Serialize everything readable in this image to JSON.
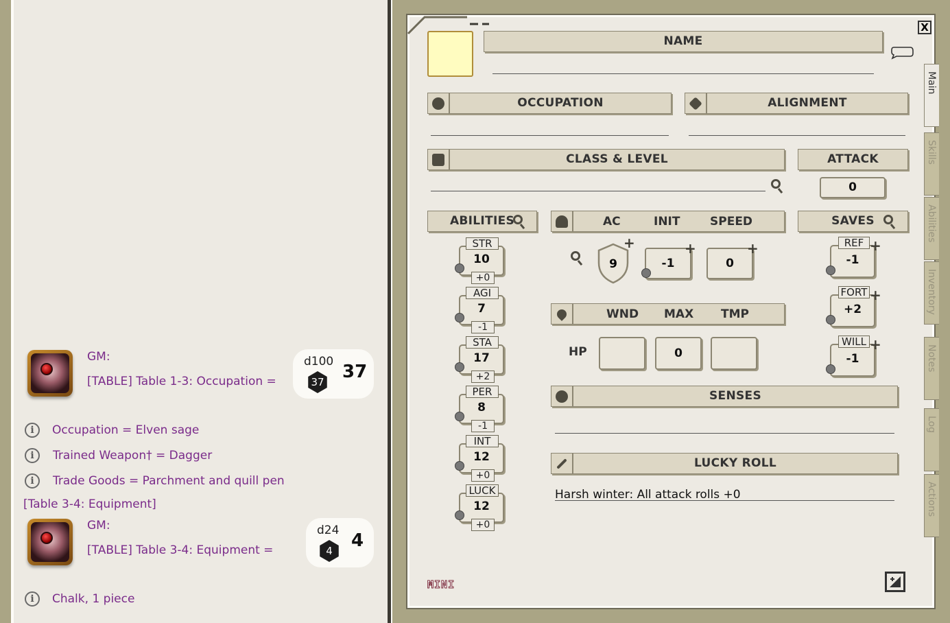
{
  "chat": {
    "msg1": {
      "speaker": "GM:",
      "text": "[TABLE] Table 1-3: Occupation =",
      "dice_label": "d100",
      "dice_roll": "37",
      "dice_total": "37"
    },
    "results1": [
      "Occupation = Elven sage",
      "Trained Weapon† = Dagger",
      "Trade Goods = Parchment and quill pen"
    ],
    "table_ref": "[Table 3-4: Equipment]",
    "msg2": {
      "speaker": "GM:",
      "text": "[TABLE] Table 3-4: Equipment =",
      "dice_label": "d24",
      "dice_roll": "4",
      "dice_total": "4"
    },
    "results2": [
      "Chalk, 1 piece"
    ]
  },
  "sheet": {
    "close": "X",
    "name_label": "NAME",
    "occupation_label": "OCCUPATION",
    "alignment_label": "ALIGNMENT",
    "class_level_label": "CLASS & LEVEL",
    "attack_label": "ATTACK",
    "attack_value": "0",
    "abilities_label": "ABILITIES",
    "abilities": [
      {
        "name": "STR",
        "value": "10",
        "mod": "+0"
      },
      {
        "name": "AGI",
        "value": "7",
        "mod": "-1"
      },
      {
        "name": "STA",
        "value": "17",
        "mod": "+2"
      },
      {
        "name": "PER",
        "value": "8",
        "mod": "-1"
      },
      {
        "name": "INT",
        "value": "12",
        "mod": "+0"
      },
      {
        "name": "LUCK",
        "value": "12",
        "mod": "+0"
      }
    ],
    "ac_label": "AC",
    "init_label": "INIT",
    "speed_label": "SPEED",
    "ac_value": "9",
    "init_value": "-1",
    "speed_value": "0",
    "saves_label": "SAVES",
    "saves": [
      {
        "name": "REF",
        "value": "-1"
      },
      {
        "name": "FORT",
        "value": "+2"
      },
      {
        "name": "WILL",
        "value": "-1"
      }
    ],
    "wnd_label": "WND",
    "max_label": "MAX",
    "tmp_label": "TMP",
    "hp_label": "HP",
    "hp_max": "0",
    "senses_label": "SENSES",
    "lucky_roll_label": "LUCKY ROLL",
    "lucky_roll_value": "Harsh winter: All attack rolls +0",
    "mini_label": "MINI",
    "tabs": [
      "Main",
      "Skills",
      "Abilities",
      "Inventory",
      "Notes",
      "Log",
      "Actions"
    ]
  }
}
